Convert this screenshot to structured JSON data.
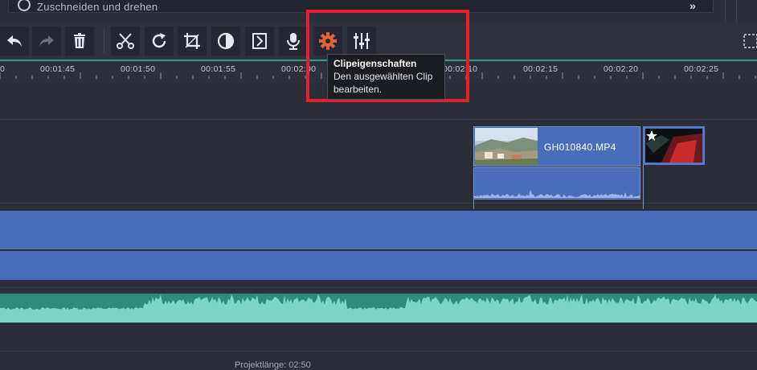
{
  "search": {
    "text": "Zuschneiden und drehen"
  },
  "toolbar": {
    "buttons": [
      {
        "name": "undo",
        "icon": "undo-icon"
      },
      {
        "name": "redo",
        "icon": "redo-icon"
      },
      {
        "name": "delete",
        "icon": "trash-icon"
      },
      {
        "name": "cut",
        "icon": "scissors-icon"
      },
      {
        "name": "rotate",
        "icon": "rotate-icon"
      },
      {
        "name": "crop",
        "icon": "crop-icon"
      },
      {
        "name": "color",
        "icon": "contrast-icon"
      },
      {
        "name": "speed",
        "icon": "speed-bracket-icon"
      },
      {
        "name": "voiceover",
        "icon": "microphone-icon"
      },
      {
        "name": "clip-properties",
        "icon": "gear-icon"
      },
      {
        "name": "mixer",
        "icon": "sliders-icon"
      }
    ],
    "active_color": "#e0643a"
  },
  "tooltip": {
    "title": "Clipeigenschaften",
    "line1": "Den ausgewählten Clip",
    "line2": "bearbeiten."
  },
  "ruler": {
    "ticks": [
      "00:01:45",
      "00:01:50",
      "00:01:55",
      "00:02:00",
      "00:02:10",
      "00:02:15",
      "00:02:20",
      "00:02:25"
    ],
    "partial_tick": "0"
  },
  "clip": {
    "name": "GH010840.MP4"
  },
  "bottom": {
    "text": "Projektlänge: 02:50"
  },
  "colors": {
    "highlight": "#e5202a",
    "track_blue": "#4a6dbb",
    "audio_teal": "#2e8c7a"
  }
}
